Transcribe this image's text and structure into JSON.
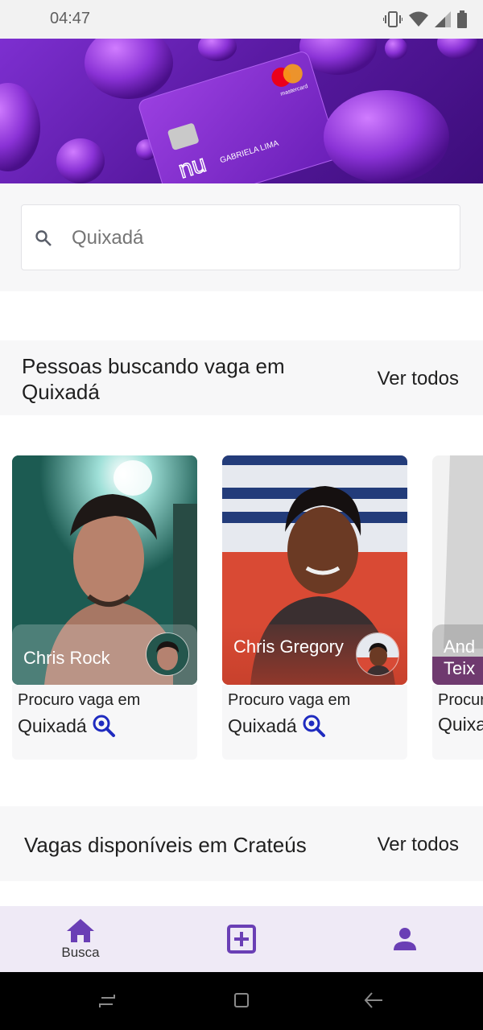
{
  "status_bar": {
    "time": "04:47"
  },
  "banner": {
    "card_holder": "GABRIELA LIMA",
    "card_brand": "mastercard",
    "card_logo": "nu"
  },
  "search": {
    "placeholder": "Quixadá",
    "value": ""
  },
  "section1": {
    "title": "Pessoas buscando vaga em Quixadá",
    "see_all": "Ver todos"
  },
  "people": [
    {
      "name": "Chris Rock",
      "line1": "Procuro vaga em",
      "city": "Quixadá"
    },
    {
      "name": "Chris Gregory",
      "line1": "Procuro vaga em",
      "city": "Quixadá"
    },
    {
      "name": "Andr Teixe",
      "line1": "Procur",
      "city": "Quixa"
    }
  ],
  "section2": {
    "title": "Vagas disponíveis em Crateús",
    "see_all": "Ver todos"
  },
  "bottom_nav": {
    "search_label": "Busca"
  },
  "colors": {
    "accent": "#6a3fb5",
    "nav_bg": "#efeaf6",
    "zoom_icon": "#1f2bbf"
  }
}
